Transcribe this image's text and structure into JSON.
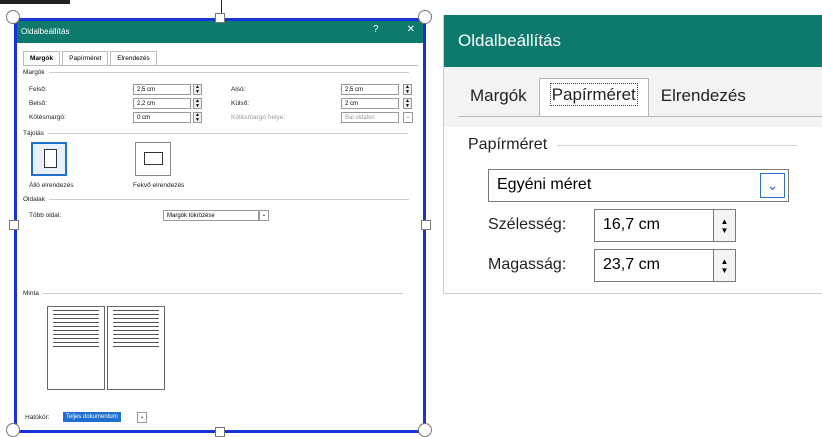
{
  "dialog_small": {
    "title": "Oldalbeállítás",
    "help": "?",
    "close": "✕",
    "tabs": [
      "Margók",
      "Papírméret",
      "Elrendezés"
    ],
    "margins_section": "Margók",
    "fields": [
      {
        "label": "Felső:",
        "value": "2,5 cm"
      },
      {
        "label": "Belső:",
        "value": "2,2 cm"
      },
      {
        "label": "Kötésmargó:",
        "value": "0 cm"
      },
      {
        "label": "Alsó:",
        "value": "2,5 cm"
      },
      {
        "label": "Külső:",
        "value": "2 cm"
      },
      {
        "label": "Kötésmargó helye:",
        "value": "Bal oldalon"
      }
    ],
    "orientation_section": "Tájolás",
    "portrait": "Álló elrendezés",
    "landscape": "Fekvő elrendezés",
    "pages_section": "Oldalak",
    "multiple_pages_label": "Több oldal:",
    "multiple_pages_value": "Margók tükrözése",
    "preview_section": "Minta",
    "apply_label": "Hatókör:",
    "apply_value": "Teljes dokumentum"
  },
  "dialog_zoom": {
    "title": "Oldalbeállítás",
    "tabs": [
      "Margók",
      "Papírméret",
      "Elrendezés"
    ],
    "active_tab": "Papírméret",
    "section": "Papírméret",
    "paper_size": "Egyéni méret",
    "width_label": "Szélesség:",
    "width_value": "16,7 cm",
    "height_label": "Magasság:",
    "height_value": "23,7 cm"
  },
  "colors": {
    "titlebar": "#0e7a6e",
    "selection_frame": "#1a33d6",
    "accent": "#2c6fce"
  }
}
